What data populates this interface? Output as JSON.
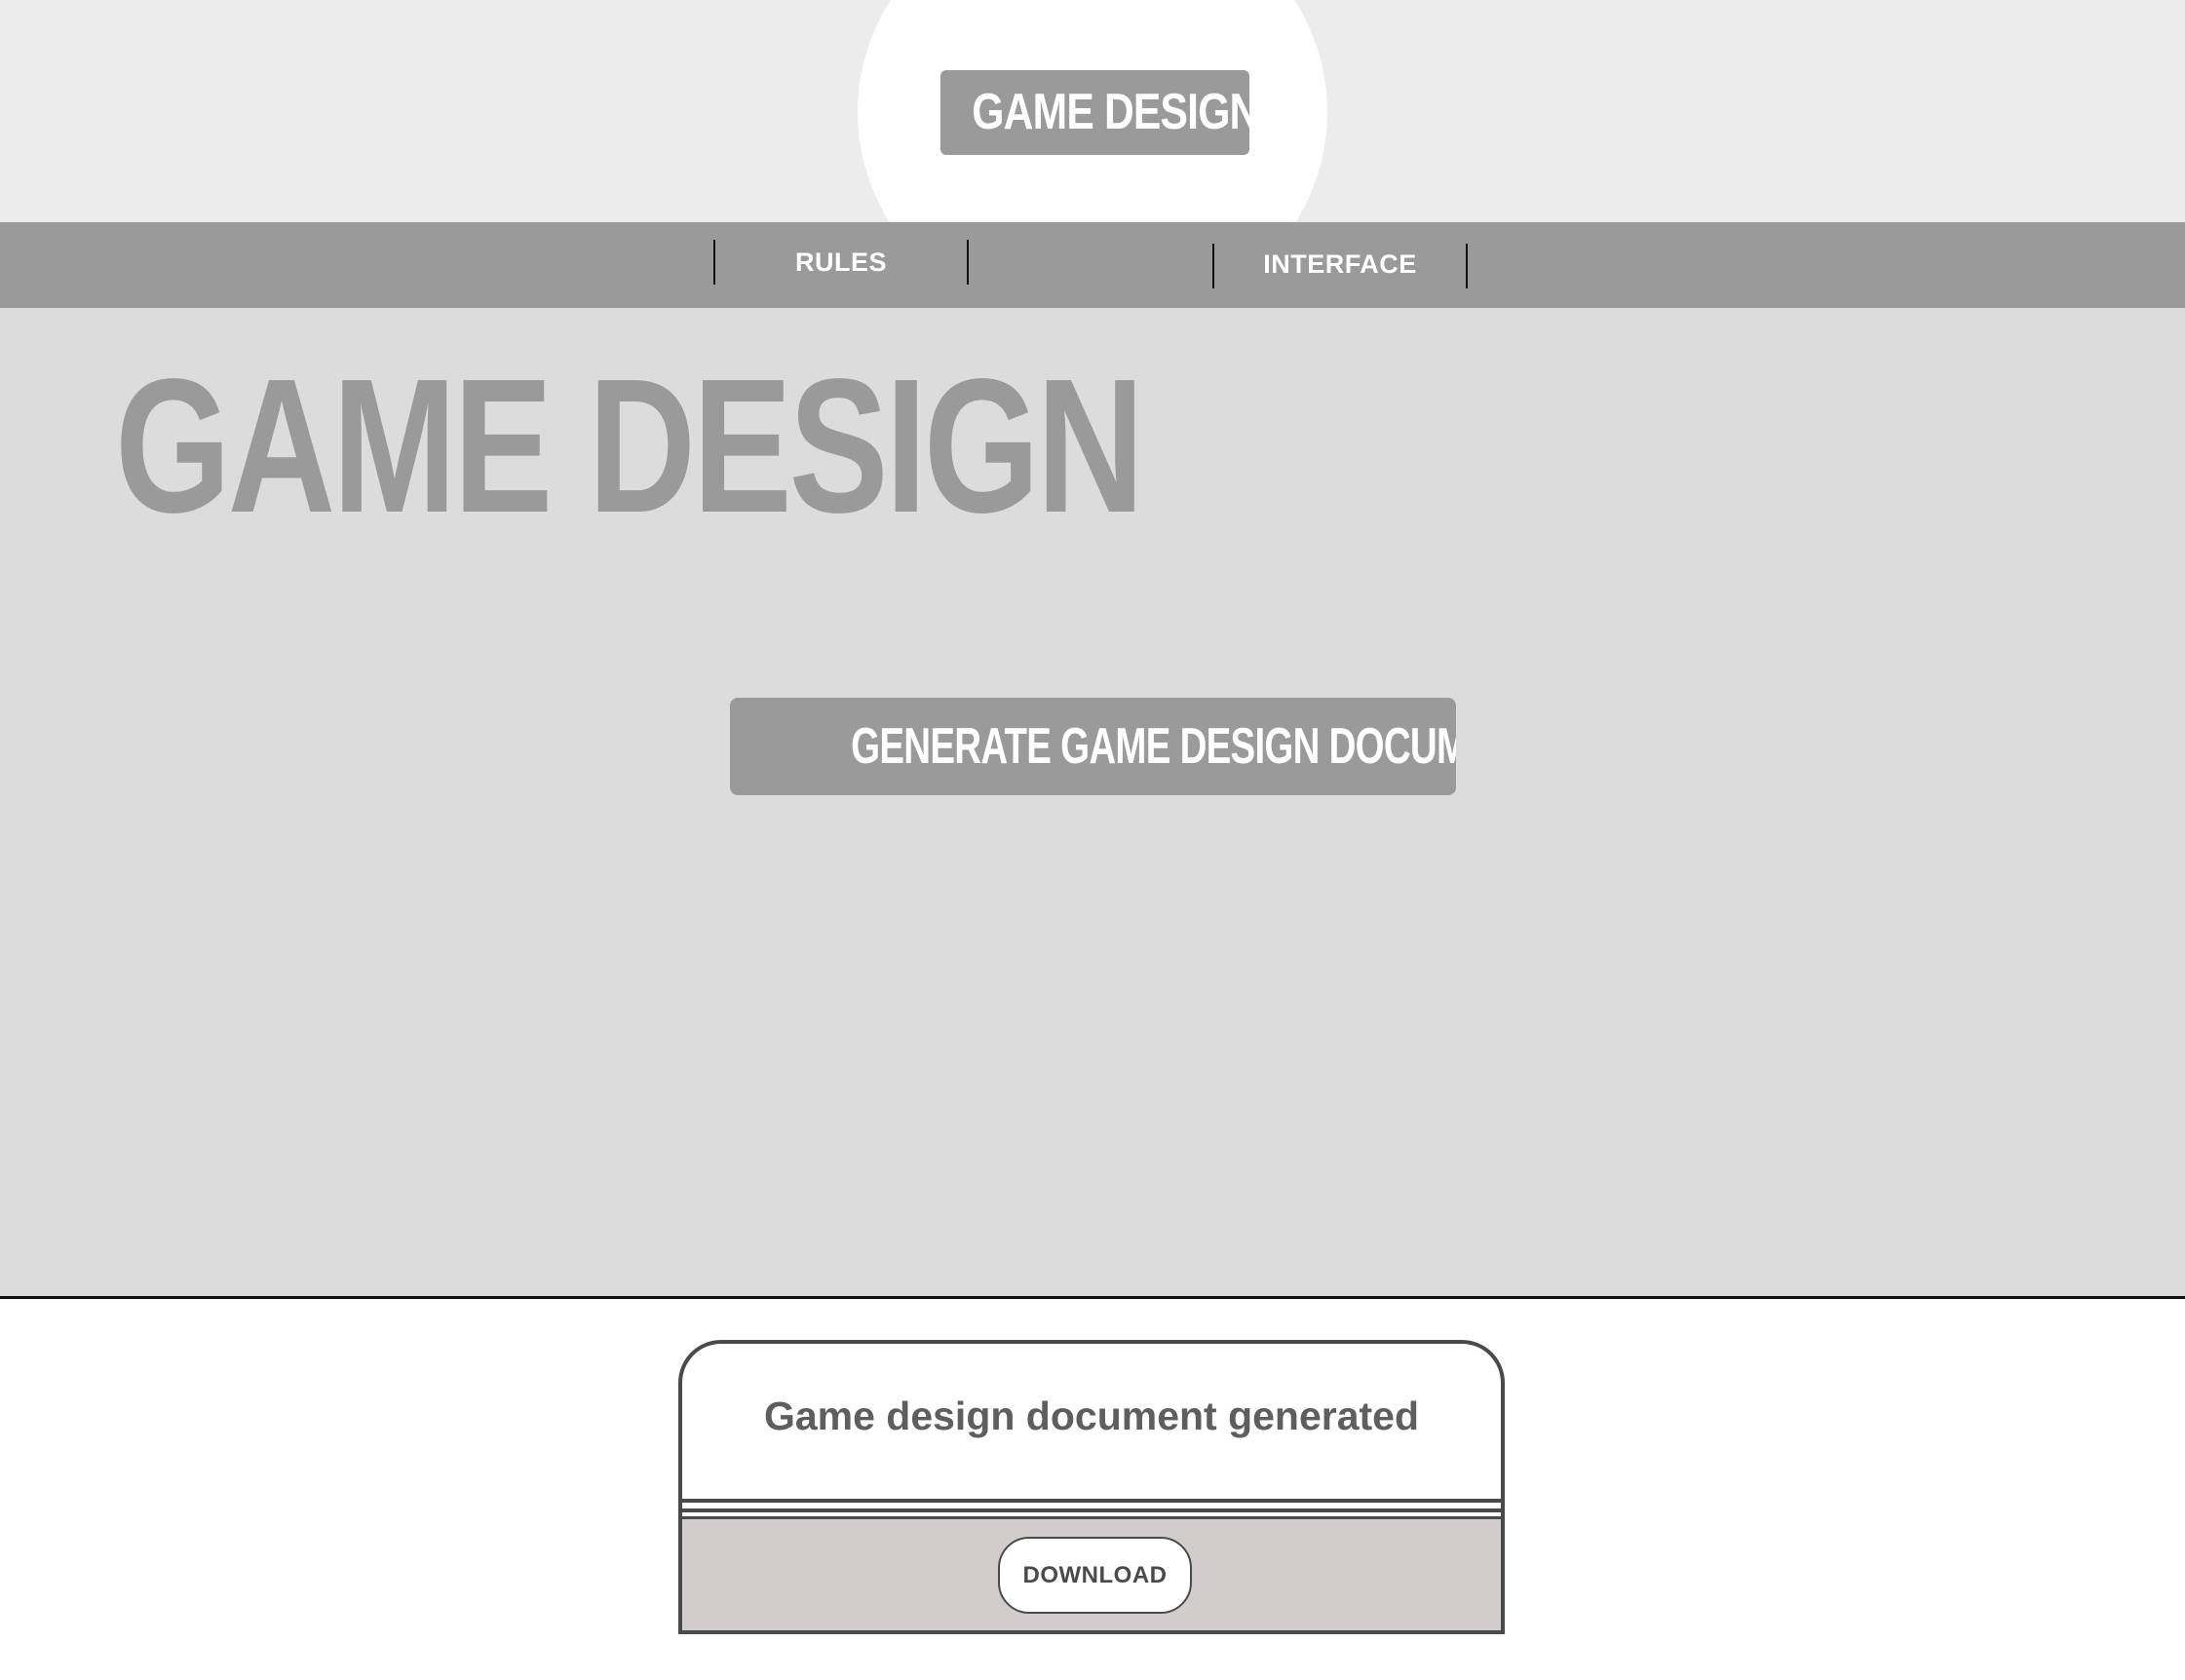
{
  "header": {
    "logo_text": "GAME DESIGN"
  },
  "nav": {
    "items": [
      {
        "label": "RULES"
      },
      {
        "label": ""
      },
      {
        "label": "INTERFACE"
      }
    ]
  },
  "main": {
    "title": "GAME DESIGN",
    "generate_button_label": "GENERATE GAME DESIGN DOCUMENT"
  },
  "dialog": {
    "message": "Game design document generated",
    "download_label": "DOWNLOAD"
  },
  "colors": {
    "header_bg": "#ececec",
    "nav_bg": "#9a9a9a",
    "main_bg": "#dcdcdc",
    "accent_gray": "#9a9a9a",
    "dialog_footer_bg": "#d1cdcd",
    "dialog_border": "#4a4a4a",
    "text_white": "#ffffff"
  }
}
